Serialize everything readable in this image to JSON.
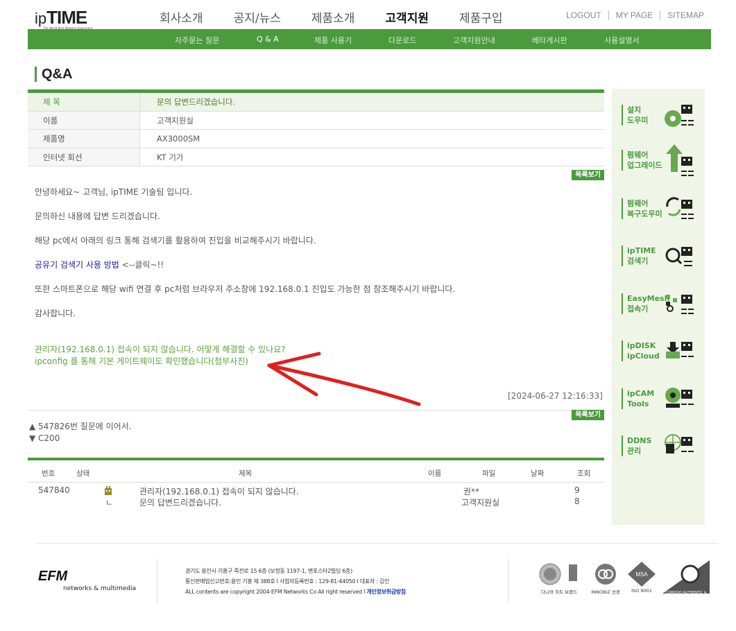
{
  "header": {
    "logo_ip": "ip",
    "logo_time": "TIME",
    "logo_tagline": "The World Best Network Equipment",
    "main_nav": [
      "회사소개",
      "공지/뉴스",
      "제품소개",
      "고객지원",
      "제품구입"
    ],
    "active_nav": "고객지원",
    "util_nav": [
      "LOGOUT",
      "MY PAGE",
      "SITEMAP"
    ],
    "sub_nav": [
      "자주묻는 질문",
      "Q & A",
      "제품 사용기",
      "다운로드",
      "고객지원안내",
      "베타게시판",
      "사용설명서"
    ]
  },
  "page_title": "Q&A",
  "info": {
    "rows": [
      {
        "key": "제 목",
        "value": "문의 답변드리겠습니다."
      },
      {
        "key": "이름",
        "value": "고객지원실"
      },
      {
        "key": "제품명",
        "value": "AX3000SM"
      },
      {
        "key": "인터넷 회선",
        "value": "KT 기가"
      }
    ]
  },
  "list_button": "목록보기",
  "content": {
    "p1": "안녕하세요~ 고객님, ipTIME 기술팀 입니다.",
    "p2": "문의하신 내용에 답변 드리겠습니다.",
    "p3": "해당 pc에서 아래의 링크 통해 검색기를 활용하여 진입을 비교해주시기 바랍니다.",
    "link": "공유기 검색기 사용 방법",
    "link_suffix": " <--클릭~!!",
    "p5": "또한 스마트폰으로 해당 wifi 연결 후 pc처럼 브라우저 주소창에 192.168.0.1 진입도 가능한 점 참조해주시기 바랍니다.",
    "p6": "감사합니다.",
    "quote1": "관리자(192.168.0.1) 접속이 되지 않습니다. 어떻게 해결할 수 있나요?",
    "quote2": "ipconfig 를 통해 기본 게이트웨이도 확인했습니다(첨부사진)"
  },
  "datetime": "[2024-06-27 12:16:33]",
  "prevnext": {
    "prev": "▲ 547826번 질문에 이어서.",
    "next": "▼ C200"
  },
  "list": {
    "headers": [
      "번호",
      "상태",
      "제목",
      "이름",
      "파일",
      "날짜",
      "조회"
    ],
    "rows": [
      {
        "num": "547840",
        "status": "",
        "title": "관리자(192.168.0.1) 접속이 되지 않습니다.",
        "name": "권**",
        "views": "9"
      },
      {
        "num": "",
        "status": "ㄴ",
        "title": "문의 답변드리겠습니다.",
        "name": "고객지원실",
        "views": "8"
      }
    ]
  },
  "sidebar": [
    {
      "label": "설치\n도우미",
      "icon": "install-helper-icon"
    },
    {
      "label": "펌웨어\n업그레이드",
      "icon": "firmware-upgrade-icon"
    },
    {
      "label": "펌웨어\n복구도우미",
      "icon": "firmware-recovery-icon"
    },
    {
      "label": "ipTIME\n검색기",
      "icon": "search-tool-icon"
    },
    {
      "label": "EasyMesh\n접속기",
      "icon": "easymesh-icon"
    },
    {
      "label": "ipDISK\nipCloud",
      "icon": "ipdisk-icon"
    },
    {
      "label": "ipCAM\nTools",
      "icon": "ipcam-icon"
    },
    {
      "label": "DDNS\n관리",
      "icon": "ddns-icon"
    }
  ],
  "footer": {
    "logo": "EFM",
    "logo_sub": "networks & multimedia",
    "addr1": "경기도 용인시 기흥구 죽전로 15 6층 (보정동 1197-1, 벤포스타2빌딩 6층)",
    "addr2": "통신판매업신고번호:용인 기흥 제 388호 I 사업자등록번호 : 129-81-44050 I 대표자 : 김인",
    "addr3": "ALL contents are copyright 2004-EFM Networks Co All right reserved I ",
    "privacy": "개인정보취급방침",
    "certs": [
      "다나와 히트 브랜드",
      "INNOBIZ 선정",
      "ISO 9001",
      "COMODO AUTHENTIC & SECURE"
    ]
  }
}
